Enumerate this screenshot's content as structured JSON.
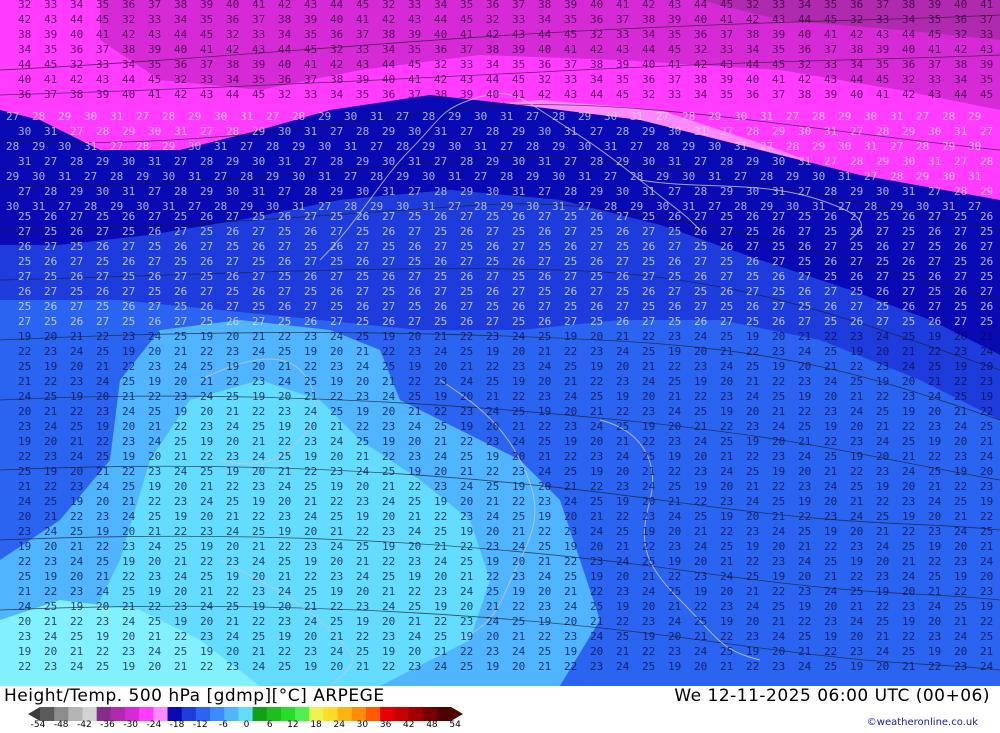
{
  "header": {
    "title_left": "Height/Temp. 500 hPa [gdmp][°C] ARPEGE",
    "title_right": "We 12-11-2025 06:00 UTC (00+06)",
    "credit": "©weatheronline.co.uk"
  },
  "legend": {
    "ticks": [
      "-54",
      "-48",
      "-42",
      "-36",
      "-30",
      "-24",
      "-18",
      "-12",
      "-6",
      "0",
      "6",
      "12",
      "18",
      "24",
      "30",
      "36",
      "42",
      "48",
      "54"
    ],
    "colors": [
      "#5a5a5a",
      "#8c8c8c",
      "#b4b4b4",
      "#d2d2d2",
      "#8a2a8a",
      "#b02ab0",
      "#d62ad6",
      "#ff3cff",
      "#ff8aff",
      "#0a0ab4",
      "#1e3cdc",
      "#2a64f0",
      "#3c8cff",
      "#50b4ff",
      "#64dcff",
      "#14a014",
      "#1ebe1e",
      "#28dc28",
      "#50f050",
      "#f0f050",
      "#ffdc28",
      "#ffb414",
      "#ff8c0a",
      "#ff5a00",
      "#e60000",
      "#c80000",
      "#a00000",
      "#780000",
      "#500000"
    ]
  },
  "map": {
    "contour_labels": {
      "north": [
        "32",
        "33",
        "34",
        "35",
        "36",
        "37",
        "38",
        "39",
        "40",
        "41",
        "42",
        "43",
        "44",
        "45"
      ],
      "jet": [
        "27",
        "28",
        "29",
        "30",
        "31"
      ],
      "center": [
        "25",
        "26",
        "27"
      ],
      "south": [
        "19",
        "20",
        "21",
        "22",
        "23",
        "24",
        "25"
      ]
    }
  }
}
